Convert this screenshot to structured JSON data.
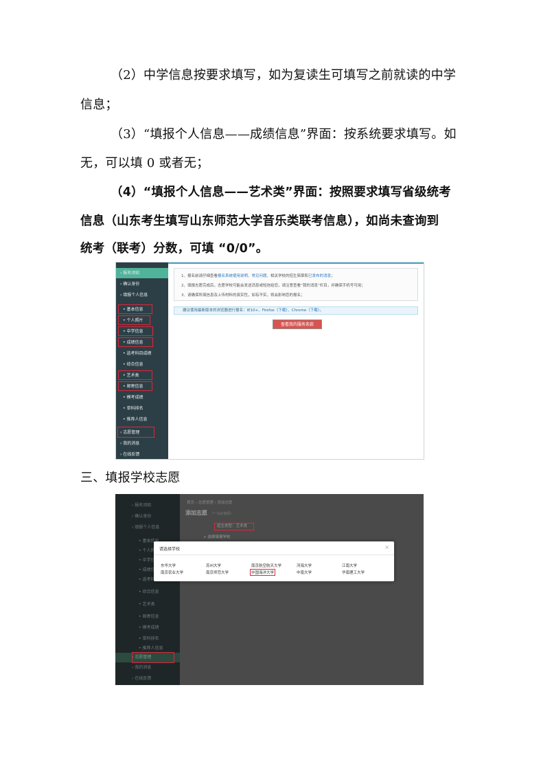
{
  "paragraphs": {
    "p1_line1": "（2）中学信息按要求填写，如为复读生可填写之前就读的中学",
    "p1_line2": "信息；",
    "p2_line1": "（3）“填报个人信息——成绩信息”界面：按系统要求填写。如",
    "p2_line2": "无，可以填 0 或者无；",
    "p3_line1": "（4）“填报个人信息——艺术类”界面：按照要求填写省级统考",
    "p3_line2": "信息（山东考生填写山东师范大学音乐类联考信息），如尚未查询到",
    "p3_line3": "统考（联考）分数，可填 “0/0”。",
    "section3": "三、填报学校志愿"
  },
  "screenshot1": {
    "sidebar": [
      {
        "label": "› 报名须知",
        "type": "main",
        "active": true
      },
      {
        "label": "› 确认身份",
        "type": "main"
      },
      {
        "label": "› 填报个人信息",
        "type": "main"
      },
      {
        "label": "• 基本信息",
        "type": "sub",
        "boxed": true
      },
      {
        "label": "• 个人照片",
        "type": "sub",
        "boxed": true
      },
      {
        "label": "• 中学信息",
        "type": "sub",
        "boxed": true
      },
      {
        "label": "• 成绩信息",
        "type": "sub",
        "boxed": true
      },
      {
        "label": "• 选考科目成绩",
        "type": "sub"
      },
      {
        "label": "• 综合信息",
        "type": "sub"
      },
      {
        "label": "• 艺术类",
        "type": "sub",
        "boxed": true
      },
      {
        "label": "• 邮寄信息",
        "type": "sub",
        "boxed": true
      },
      {
        "label": "• 模考成绩",
        "type": "sub"
      },
      {
        "label": "• 单科排名",
        "type": "sub"
      },
      {
        "label": "• 推荐人信息",
        "type": "sub"
      },
      {
        "label": "› 志愿管理",
        "type": "main",
        "boxed": true
      },
      {
        "label": "› 我的消息",
        "type": "main"
      },
      {
        "label": "› 在线反馈",
        "type": "main"
      }
    ],
    "notice": {
      "line1_a": "1、报名前请仔细查看",
      "line1_link1": "报名系统使用说明",
      "line1_b": "、",
      "line1_link2": "常见问题",
      "line1_c": "、相关学校的招生简章和",
      "line1_link3": "已发布的消息",
      "line1_d": "；",
      "line2": "2、填报志愿完成后，志愿学校可能会发送消息或短信给您，请注意查看“我的消息”栏目，并确保手机号可用；",
      "line3": "3、请确保所填信息及上传材料的真实性，如有不实，将会影响您的报名；"
    },
    "tip": {
      "a": "建议使用最新版本的浏览器进行报名：IE10+、Firefox（",
      "link1": "下载",
      "b": "）、Chrome（",
      "link2": "下载",
      "c": "）。"
    },
    "button": "查看我的服务条款"
  },
  "screenshot2": {
    "sidebar": [
      {
        "label": "› 报名须知",
        "type": "main"
      },
      {
        "label": "› 确认身份",
        "type": "main"
      },
      {
        "label": "› 填报个人信息",
        "type": "main"
      },
      {
        "label": "• 基本信息",
        "type": "sub"
      },
      {
        "label": "• 个人照片",
        "type": "sub"
      },
      {
        "label": "• 中学信息",
        "type": "sub"
      },
      {
        "label": "• 成绩信息",
        "type": "sub"
      },
      {
        "label": "• 选考科目成绩",
        "type": "sub"
      },
      {
        "label": "• 综合信息",
        "type": "sub"
      },
      {
        "label": "• 艺术类",
        "type": "sub"
      },
      {
        "label": "• 邮寄信息",
        "type": "sub"
      },
      {
        "label": "• 模考成绩",
        "type": "sub"
      },
      {
        "label": "• 单科排名",
        "type": "sub"
      },
      {
        "label": "• 推荐人信息",
        "type": "sub"
      },
      {
        "label": "› 志愿管理",
        "type": "main",
        "highlight": true
      },
      {
        "label": "› 我的消息",
        "type": "main"
      },
      {
        "label": "› 在线反馈",
        "type": "main"
      }
    ],
    "breadcrumb": "首页 › 志愿管理 › 添加志愿",
    "page_title": "添加志愿",
    "page_title_note": "（* 为必填项）",
    "select_label": "招生类型：艺术类",
    "choose_school": "+ 选择填报学校",
    "modal": {
      "title": "请选择学校",
      "close": "×",
      "schools_row1": [
        "东华大学",
        "苏州大学",
        "南京航空航天大学",
        "河海大学",
        "江南大学"
      ],
      "schools_row2": [
        "南京农业大学",
        "南京师范大学",
        "中国海洋大学",
        "中南大学",
        "华南理工大学"
      ]
    }
  }
}
